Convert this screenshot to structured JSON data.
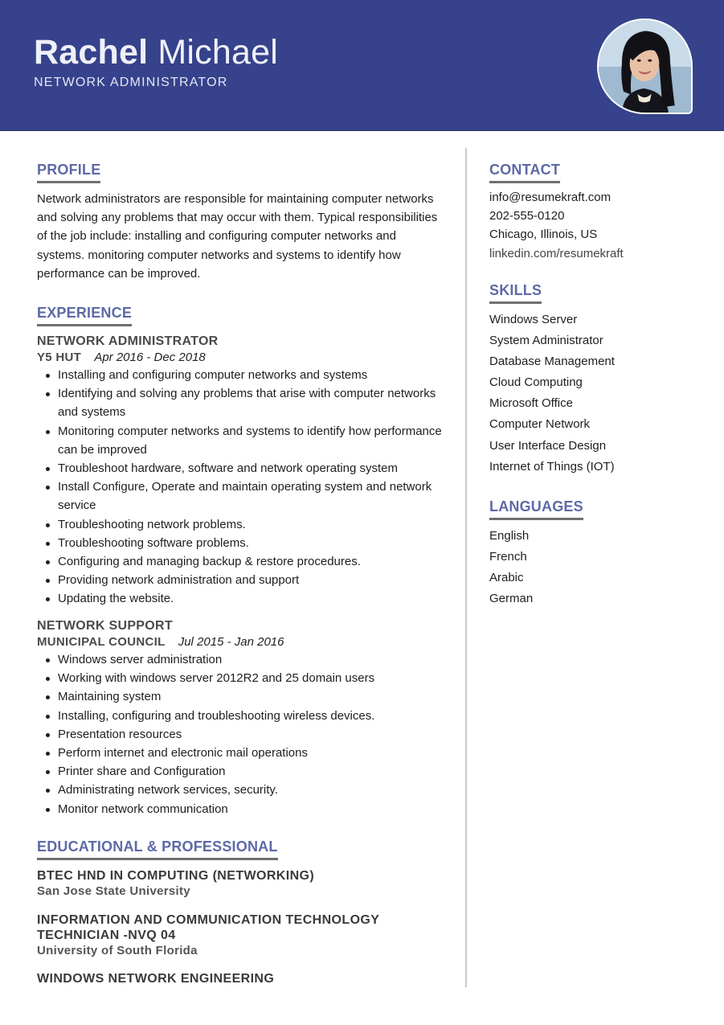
{
  "header": {
    "first_name": "Rachel",
    "last_name": "Michael",
    "job_title": "NETWORK ADMINISTRATOR",
    "background_color": "#36428b",
    "photo": "profile-photo"
  },
  "profile": {
    "heading": "PROFILE",
    "text": "Network administrators are responsible for maintaining computer networks and solving any problems that may occur with them. Typical responsibilities of the job include: installing and configuring computer networks and systems. monitoring computer networks and systems to identify how performance can be improved."
  },
  "experience": {
    "heading": "EXPERIENCE",
    "jobs": [
      {
        "title": "NETWORK ADMINISTRATOR",
        "company": "Y5 HUT",
        "dates": "Apr 2016 - Dec 2018",
        "bullets": [
          "Installing and configuring computer networks and systems",
          "Identifying and solving any problems that arise with computer networks and systems",
          "Monitoring computer networks and systems to identify how performance can be improved",
          "Troubleshoot hardware, software and network operating system",
          "Install Configure, Operate and maintain operating system and network service",
          "Troubleshooting network problems.",
          "Troubleshooting software problems.",
          "Configuring and managing backup & restore procedures.",
          "Providing network administration and support",
          "Updating the website."
        ]
      },
      {
        "title": "NETWORK SUPPORT",
        "company": "MUNICIPAL COUNCIL",
        "dates": "Jul 2015 - Jan 2016",
        "bullets": [
          "Windows server administration",
          "Working with windows server 2012R2 and 25 domain users",
          "Maintaining system",
          "Installing, configuring and troubleshooting wireless devices.",
          "Presentation resources",
          "Perform internet and electronic mail operations",
          "Printer share and Configuration",
          "Administrating network services, security.",
          "Monitor network communication"
        ]
      }
    ]
  },
  "education": {
    "heading": "EDUCATIONAL & PROFESSIONAL",
    "items": [
      {
        "title": "BTEC HND IN COMPUTING (NETWORKING)",
        "school": "San Jose State University"
      },
      {
        "title": "INFORMATION AND COMMUNICATION TECHNOLOGY TECHNICIAN -NVQ 04",
        "school": "University of South Florida"
      },
      {
        "title": "WINDOWS NETWORK ENGINEERING",
        "school": ""
      }
    ]
  },
  "contact": {
    "heading": "CONTACT",
    "email": "info@resumekraft.com",
    "phone": "202-555-0120",
    "location": "Chicago, Illinois, US",
    "linkedin": "linkedin.com/resumekraft"
  },
  "skills": {
    "heading": "SKILLS",
    "items": [
      "Windows Server",
      "System Administrator",
      "Database Management",
      "Cloud Computing",
      "Microsoft Office",
      "Computer Network",
      "User Interface Design",
      "Internet of Things (IOT)"
    ]
  },
  "languages": {
    "heading": "LANGUAGES",
    "items": [
      "English",
      "French",
      "Arabic",
      "German"
    ]
  },
  "colors": {
    "accent": "#5d6aa6",
    "header": "#36428b",
    "underline": "#707070",
    "divider": "#c9c9c9"
  }
}
